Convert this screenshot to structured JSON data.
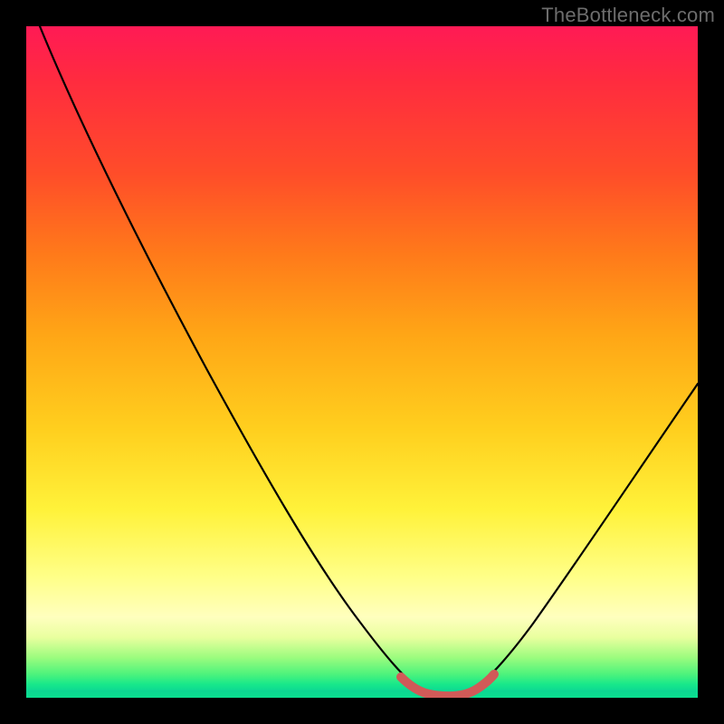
{
  "watermark": "TheBottleneck.com",
  "chart_data": {
    "type": "line",
    "title": "",
    "xlabel": "",
    "ylabel": "",
    "xlim": [
      0,
      100
    ],
    "ylim": [
      0,
      100
    ],
    "series": [
      {
        "name": "curve",
        "x": [
          2,
          10,
          20,
          30,
          40,
          48,
          52,
          55,
          58,
          60,
          62,
          63,
          64,
          66,
          70,
          75,
          80,
          90,
          100
        ],
        "values": [
          100,
          83,
          66,
          49,
          34,
          20,
          12,
          7,
          3,
          1,
          0.5,
          0.5,
          1,
          3,
          8,
          15,
          22,
          37,
          52
        ]
      },
      {
        "name": "bottom-marker",
        "x": [
          55,
          56,
          57,
          58,
          59,
          60,
          61,
          62,
          63,
          64,
          65,
          66
        ],
        "values": [
          2.9,
          2.0,
          1.3,
          0.8,
          0.5,
          0.4,
          0.4,
          0.5,
          0.8,
          1.3,
          2.0,
          2.9
        ]
      }
    ],
    "colors": {
      "curve": "#000000",
      "bottom_marker": "#d15a58"
    }
  }
}
